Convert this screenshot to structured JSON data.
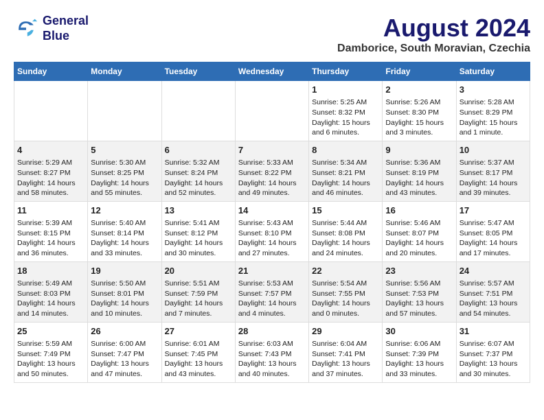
{
  "logo": {
    "line1": "General",
    "line2": "Blue"
  },
  "title": "August 2024",
  "subtitle": "Damborice, South Moravian, Czechia",
  "days_of_week": [
    "Sunday",
    "Monday",
    "Tuesday",
    "Wednesday",
    "Thursday",
    "Friday",
    "Saturday"
  ],
  "weeks": [
    {
      "days": [
        {
          "num": "",
          "text": ""
        },
        {
          "num": "",
          "text": ""
        },
        {
          "num": "",
          "text": ""
        },
        {
          "num": "",
          "text": ""
        },
        {
          "num": "1",
          "text": "Sunrise: 5:25 AM\nSunset: 8:32 PM\nDaylight: 15 hours\nand 6 minutes."
        },
        {
          "num": "2",
          "text": "Sunrise: 5:26 AM\nSunset: 8:30 PM\nDaylight: 15 hours\nand 3 minutes."
        },
        {
          "num": "3",
          "text": "Sunrise: 5:28 AM\nSunset: 8:29 PM\nDaylight: 15 hours\nand 1 minute."
        }
      ]
    },
    {
      "days": [
        {
          "num": "4",
          "text": "Sunrise: 5:29 AM\nSunset: 8:27 PM\nDaylight: 14 hours\nand 58 minutes."
        },
        {
          "num": "5",
          "text": "Sunrise: 5:30 AM\nSunset: 8:25 PM\nDaylight: 14 hours\nand 55 minutes."
        },
        {
          "num": "6",
          "text": "Sunrise: 5:32 AM\nSunset: 8:24 PM\nDaylight: 14 hours\nand 52 minutes."
        },
        {
          "num": "7",
          "text": "Sunrise: 5:33 AM\nSunset: 8:22 PM\nDaylight: 14 hours\nand 49 minutes."
        },
        {
          "num": "8",
          "text": "Sunrise: 5:34 AM\nSunset: 8:21 PM\nDaylight: 14 hours\nand 46 minutes."
        },
        {
          "num": "9",
          "text": "Sunrise: 5:36 AM\nSunset: 8:19 PM\nDaylight: 14 hours\nand 43 minutes."
        },
        {
          "num": "10",
          "text": "Sunrise: 5:37 AM\nSunset: 8:17 PM\nDaylight: 14 hours\nand 39 minutes."
        }
      ]
    },
    {
      "days": [
        {
          "num": "11",
          "text": "Sunrise: 5:39 AM\nSunset: 8:15 PM\nDaylight: 14 hours\nand 36 minutes."
        },
        {
          "num": "12",
          "text": "Sunrise: 5:40 AM\nSunset: 8:14 PM\nDaylight: 14 hours\nand 33 minutes."
        },
        {
          "num": "13",
          "text": "Sunrise: 5:41 AM\nSunset: 8:12 PM\nDaylight: 14 hours\nand 30 minutes."
        },
        {
          "num": "14",
          "text": "Sunrise: 5:43 AM\nSunset: 8:10 PM\nDaylight: 14 hours\nand 27 minutes."
        },
        {
          "num": "15",
          "text": "Sunrise: 5:44 AM\nSunset: 8:08 PM\nDaylight: 14 hours\nand 24 minutes."
        },
        {
          "num": "16",
          "text": "Sunrise: 5:46 AM\nSunset: 8:07 PM\nDaylight: 14 hours\nand 20 minutes."
        },
        {
          "num": "17",
          "text": "Sunrise: 5:47 AM\nSunset: 8:05 PM\nDaylight: 14 hours\nand 17 minutes."
        }
      ]
    },
    {
      "days": [
        {
          "num": "18",
          "text": "Sunrise: 5:49 AM\nSunset: 8:03 PM\nDaylight: 14 hours\nand 14 minutes."
        },
        {
          "num": "19",
          "text": "Sunrise: 5:50 AM\nSunset: 8:01 PM\nDaylight: 14 hours\nand 10 minutes."
        },
        {
          "num": "20",
          "text": "Sunrise: 5:51 AM\nSunset: 7:59 PM\nDaylight: 14 hours\nand 7 minutes."
        },
        {
          "num": "21",
          "text": "Sunrise: 5:53 AM\nSunset: 7:57 PM\nDaylight: 14 hours\nand 4 minutes."
        },
        {
          "num": "22",
          "text": "Sunrise: 5:54 AM\nSunset: 7:55 PM\nDaylight: 14 hours\nand 0 minutes."
        },
        {
          "num": "23",
          "text": "Sunrise: 5:56 AM\nSunset: 7:53 PM\nDaylight: 13 hours\nand 57 minutes."
        },
        {
          "num": "24",
          "text": "Sunrise: 5:57 AM\nSunset: 7:51 PM\nDaylight: 13 hours\nand 54 minutes."
        }
      ]
    },
    {
      "days": [
        {
          "num": "25",
          "text": "Sunrise: 5:59 AM\nSunset: 7:49 PM\nDaylight: 13 hours\nand 50 minutes."
        },
        {
          "num": "26",
          "text": "Sunrise: 6:00 AM\nSunset: 7:47 PM\nDaylight: 13 hours\nand 47 minutes."
        },
        {
          "num": "27",
          "text": "Sunrise: 6:01 AM\nSunset: 7:45 PM\nDaylight: 13 hours\nand 43 minutes."
        },
        {
          "num": "28",
          "text": "Sunrise: 6:03 AM\nSunset: 7:43 PM\nDaylight: 13 hours\nand 40 minutes."
        },
        {
          "num": "29",
          "text": "Sunrise: 6:04 AM\nSunset: 7:41 PM\nDaylight: 13 hours\nand 37 minutes."
        },
        {
          "num": "30",
          "text": "Sunrise: 6:06 AM\nSunset: 7:39 PM\nDaylight: 13 hours\nand 33 minutes."
        },
        {
          "num": "31",
          "text": "Sunrise: 6:07 AM\nSunset: 7:37 PM\nDaylight: 13 hours\nand 30 minutes."
        }
      ]
    }
  ]
}
